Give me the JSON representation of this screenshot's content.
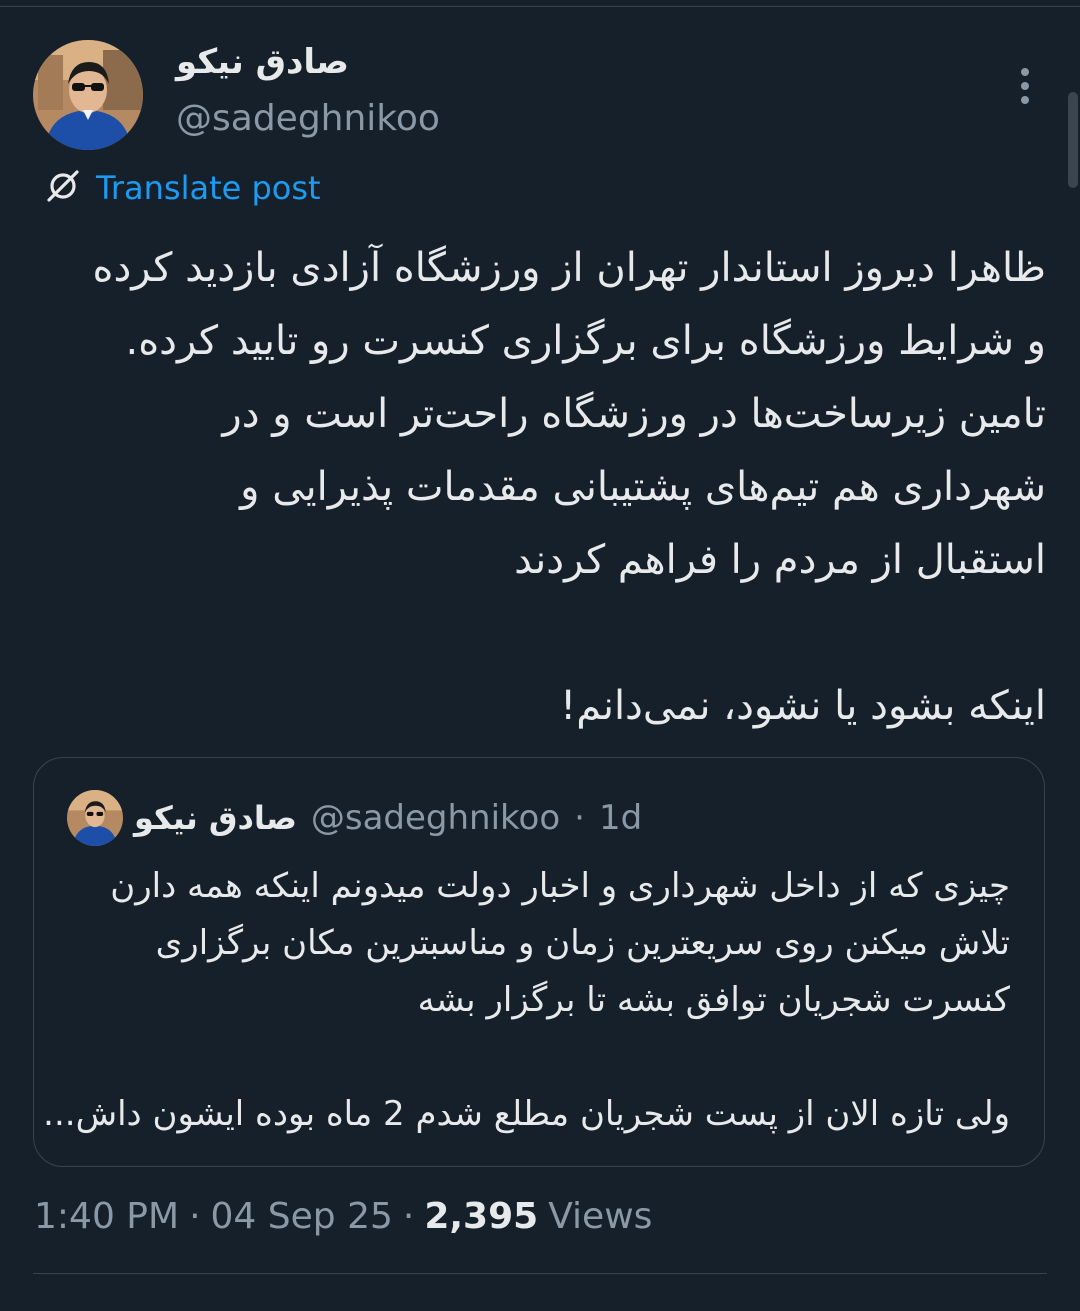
{
  "author": {
    "display_name": "صادق نیکو",
    "handle": "@sadeghnikoo"
  },
  "icons": {
    "more": "more-vertical-icon",
    "translate": "translate-icon"
  },
  "colors": {
    "background": "#15202b",
    "accent": "#1d9bf0",
    "text": "#e7e9ea",
    "muted": "#8b98a5",
    "border": "#38444d"
  },
  "translate_label": "Translate post",
  "post": {
    "lines": [
      "ظاهرا دیروز استاندار تهران از ورزشگاه آزادی بازدید کرده",
      "و شرایط ورزشگاه برای برگزاری کنسرت رو تایید کرده.",
      "تامین زیرساخت‌ها در ورزشگاه راحت‌تر است و در",
      "شهرداری هم تیم‌های پشتیبانی مقدمات پذیرایی و",
      "استقبال از مردم را فراهم کردند",
      "اینکه بشود یا نشود، نمی‌دانم!"
    ]
  },
  "quoted_post": {
    "display_name": "صادق نیکو",
    "handle": "@sadeghnikoo",
    "separator": "·",
    "age": "1d",
    "lines": [
      "چیزی که از داخل شهرداری و اخبار دولت میدونم اینکه همه دارن",
      "تلاش میکنن روی سریعترین زمان و مناسبترین مکان برگزاری",
      "کنسرت شجریان توافق بشه تا برگزار بشه",
      "ولی تازه الان از پست شجریان مطلع شدم 2 ماه بوده ایشون داش..."
    ]
  },
  "meta": {
    "time": "1:40 PM",
    "date": "04 Sep 25",
    "separator": "·",
    "views_count": "2,395",
    "views_label": "Views"
  }
}
